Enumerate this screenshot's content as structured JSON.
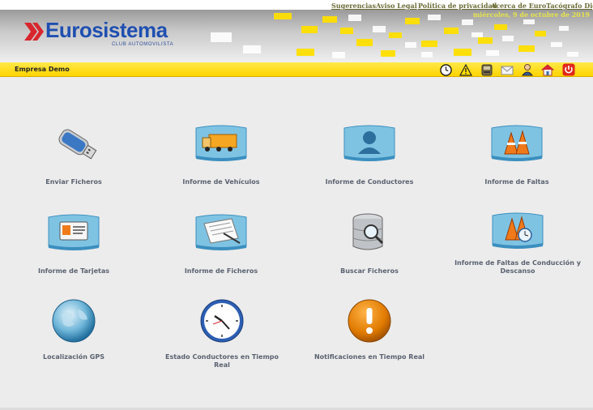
{
  "top_links": [
    "Sugerencias",
    "Aviso Legal",
    "Política de privacidad",
    "Acerca de EuroTacógrafo Digital"
  ],
  "banner": {
    "date": "miércoles, 9 de octubre de 2019",
    "logo_text": "Eurosistema",
    "logo_sub": "CLUB AUTOMOVILISTA"
  },
  "toolbar": {
    "company": "Empresa Demo",
    "icons": [
      "clock-icon",
      "warning-icon",
      "tachograph-icon",
      "mail-icon",
      "user-icon",
      "home-icon",
      "power-icon"
    ]
  },
  "main": {
    "items": [
      {
        "label": "Enviar Ficheros",
        "icon": "usb-drive-icon"
      },
      {
        "label": "Informe de Vehículos",
        "icon": "truck-icon"
      },
      {
        "label": "Informe de Conductores",
        "icon": "driver-icon"
      },
      {
        "label": "Informe de Faltas",
        "icon": "cones-icon"
      },
      {
        "label": "Informe de Tarjetas",
        "icon": "card-icon"
      },
      {
        "label": "Informe de Ficheros",
        "icon": "document-icon"
      },
      {
        "label": "Buscar Ficheros",
        "icon": "database-search-icon"
      },
      {
        "label": "Informe de Faltas de Conducción y Descanso",
        "icon": "cones-clock-icon"
      },
      {
        "label": "Localización GPS",
        "icon": "globe-icon"
      },
      {
        "label": "Estado Conductores en Tiempo Real",
        "icon": "clock-icon"
      },
      {
        "label": "Notificaciones en Tiempo Real",
        "icon": "alert-icon"
      }
    ]
  },
  "colors": {
    "toolbar_yellow": "#ffd400",
    "logo_blue": "#1f4fb0",
    "logo_red": "#d8262e",
    "label_gray": "#5a6270",
    "link_olive": "#6b6b36"
  }
}
